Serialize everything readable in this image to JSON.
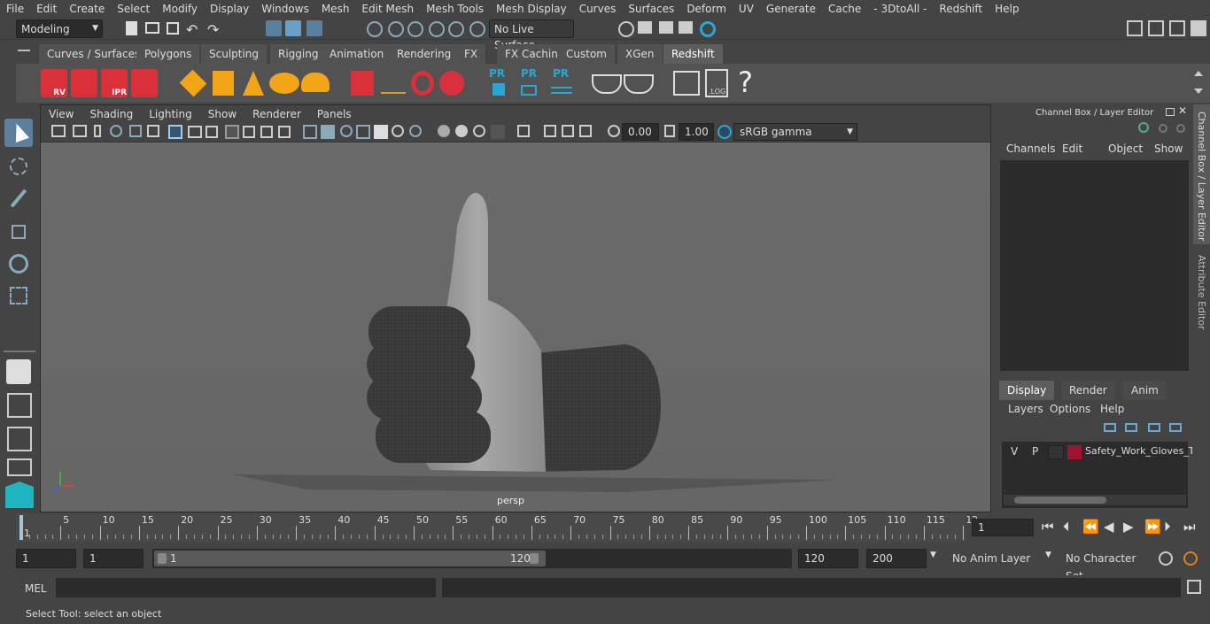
{
  "menubar": {
    "items": [
      "File",
      "Edit",
      "Create",
      "Select",
      "Modify",
      "Display",
      "Windows",
      "Mesh",
      "Edit Mesh",
      "Mesh Tools",
      "Mesh Display",
      "Curves",
      "Surfaces",
      "Deform",
      "UV",
      "Generate",
      "Cache",
      "- 3DtoAll -",
      "Redshift",
      "Help"
    ]
  },
  "statusline": {
    "mode": "Modeling",
    "live_surface": "No Live Surface"
  },
  "shelf": {
    "tabs": [
      "Curves / Surfaces",
      "Polygons",
      "Sculpting",
      "Rigging",
      "Animation",
      "Rendering",
      "FX",
      "FX Caching",
      "Custom",
      "XGen",
      "Redshift"
    ],
    "active_tab": "Redshift",
    "icon_labels": {
      "rv": "RV",
      "ipr": "IPR",
      "pr1": "PR",
      "pr2": "PR",
      "pr3": "PR",
      "log": ".LOG",
      "help": "?"
    }
  },
  "viewport": {
    "menus": [
      "View",
      "Shading",
      "Lighting",
      "Show",
      "Renderer",
      "Panels"
    ],
    "exposure": "0.00",
    "gamma": "1.00",
    "color_space": "sRGB gamma",
    "camera_label": "persp"
  },
  "channelbox": {
    "title": "Channel Box / Layer Editor",
    "menus": [
      "Channels",
      "Edit",
      "Object",
      "Show"
    ]
  },
  "layers": {
    "tabs": [
      "Display",
      "Render",
      "Anim"
    ],
    "active_tab": "Display",
    "menus": [
      "Layers",
      "Options",
      "Help"
    ],
    "rows": [
      {
        "v": "V",
        "p": "P",
        "name": "Safety_Work_Gloves_T",
        "color": "#a0142d"
      }
    ]
  },
  "side_tabs": {
    "channel_box": "Channel Box / Layer Editor",
    "attribute_editor": "Attribute Editor"
  },
  "timeline": {
    "ticks": [
      "1",
      "5",
      "10",
      "15",
      "20",
      "25",
      "30",
      "35",
      "40",
      "45",
      "50",
      "55",
      "60",
      "65",
      "70",
      "75",
      "80",
      "85",
      "90",
      "95",
      "100",
      "105",
      "110",
      "115",
      "12"
    ],
    "current_frame": "1"
  },
  "range": {
    "start": "1",
    "playback_start": "1",
    "slider_start": "1",
    "slider_end": "120",
    "playback_end": "120",
    "end": "200",
    "anim_layer": "No Anim Layer",
    "character_set": "No Character Set"
  },
  "mel": {
    "label": "MEL"
  },
  "help_line": {
    "text": "Select Tool: select an object"
  }
}
